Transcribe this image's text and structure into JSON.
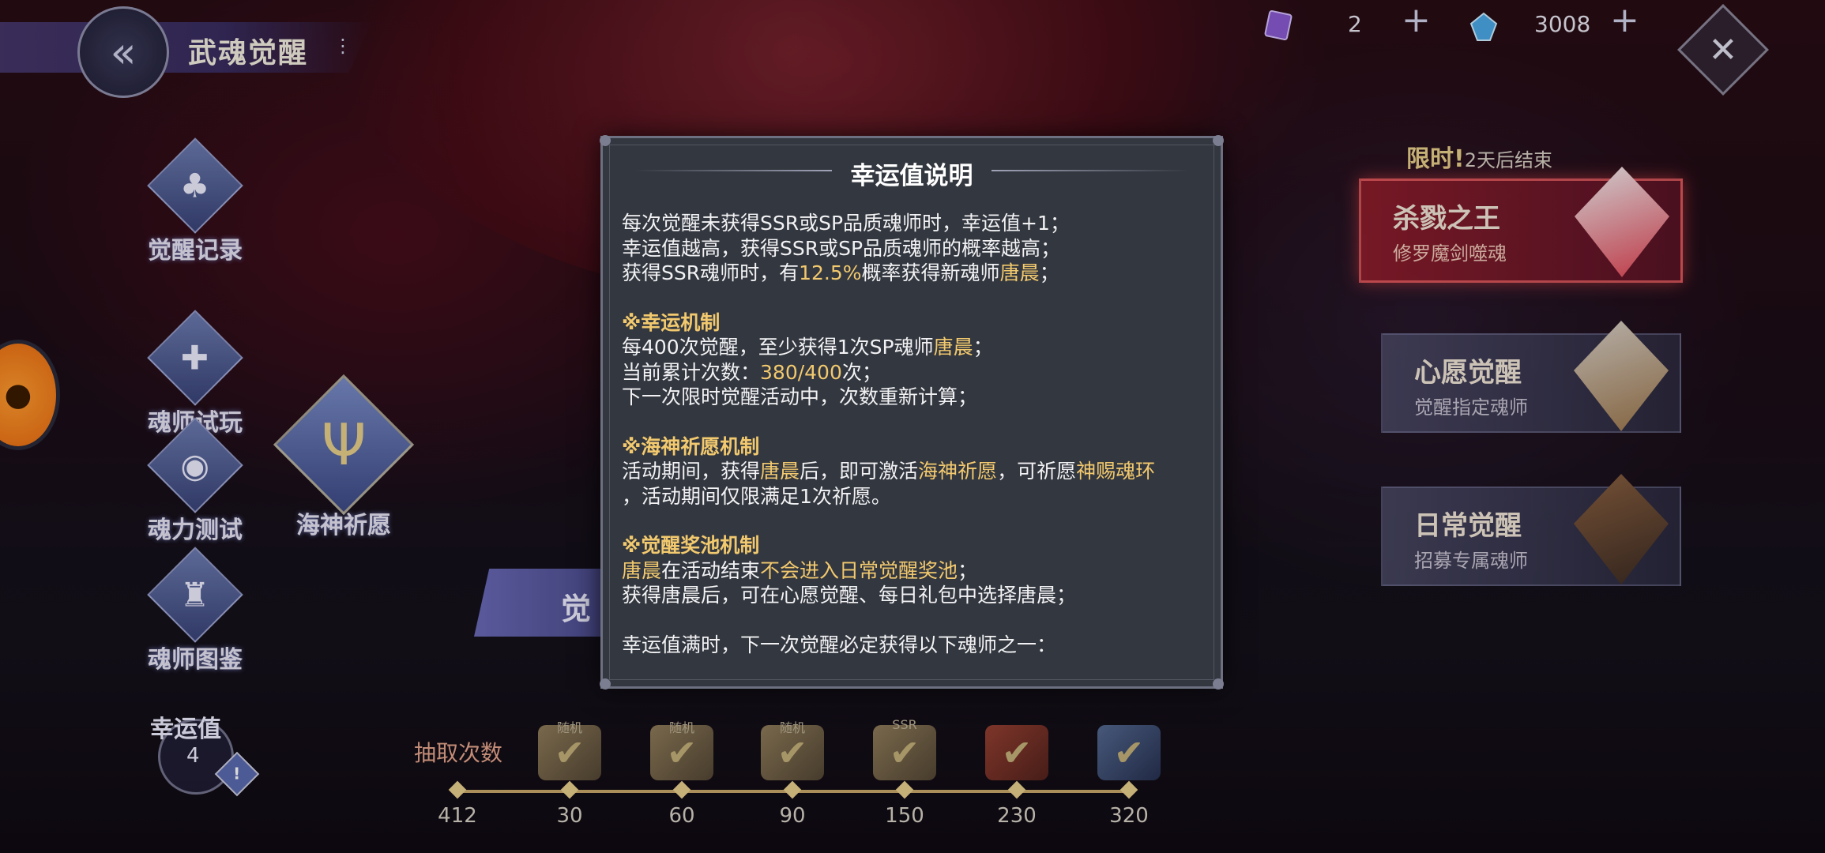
{
  "header": {
    "title": "武魂觉醒",
    "info_glyph": "⋮",
    "back_glyph": "«",
    "close_glyph": "✕"
  },
  "currencies": [
    {
      "icon": "purple-ticket-icon",
      "value": "2",
      "plus": "+"
    },
    {
      "icon": "blue-crystal-icon",
      "value": "3008",
      "plus": "+"
    }
  ],
  "left_menu": {
    "record": {
      "label": "觉醒记录",
      "icon": "card-record-icon",
      "glyph": "♣"
    },
    "trial": {
      "label": "魂师试玩",
      "icon": "gamepad-icon",
      "glyph": "✚"
    },
    "soul_test": {
      "label": "魂力测试",
      "icon": "camera-icon",
      "glyph": "◉"
    },
    "poseidon": {
      "label": "海神祈愿",
      "icon": "trident-icon",
      "glyph": "Ψ"
    },
    "codex": {
      "label": "魂师图鉴",
      "icon": "helmet-icon",
      "glyph": "♜"
    }
  },
  "luck": {
    "label": "幸运值",
    "value": "4",
    "info": "!"
  },
  "center_banner": {
    "label": "觉"
  },
  "draw_track": {
    "label": "抽取次数",
    "ticks": [
      "412",
      "30",
      "60",
      "90",
      "150",
      "230",
      "320"
    ],
    "rewards": [
      {
        "tag": "随机",
        "icon": "ssr-check-reward-icon"
      },
      {
        "tag": "随机",
        "icon": "ssr-check-reward-icon"
      },
      {
        "tag": "随机",
        "icon": "ssr-check-reward-icon"
      },
      {
        "tag": "SSR",
        "icon": "ssr-feather-reward-icon"
      },
      {
        "tag": "",
        "icon": "red-chest-reward-icon"
      },
      {
        "tag": "",
        "icon": "blue-chest-reward-icon"
      }
    ],
    "check_glyph": "✔"
  },
  "events": {
    "limit_label": "限时",
    "limit_time": "2天后结束",
    "cards": [
      {
        "title": "杀戮之王",
        "subtitle": "修罗魔剑噬魂",
        "portrait": "white-hair-demon-portrait"
      },
      {
        "title": "心愿觉醒",
        "subtitle": "觉醒指定魂师",
        "portrait": "goggles-boy-portrait"
      },
      {
        "title": "日常觉醒",
        "subtitle": "招募专属魂师",
        "portrait": "bearded-man-portrait"
      }
    ]
  },
  "popup": {
    "title": "幸运值说明",
    "intro": {
      "line1": "每次觉醒未获得SSR或SP品质魂师时，幸运值+1；",
      "line2": "幸运值越高，获得SSR或SP品质魂师的概率越高；",
      "line3_a": "获得SSR魂师时，有",
      "line3_rate": "12.5%",
      "line3_b": "概率获得新魂师",
      "line3_name": "唐晨",
      "line3_c": "；"
    },
    "luck_mech": {
      "heading": "※幸运机制",
      "line1_a": "每400次觉醒，至少获得1次SP魂师",
      "line1_name": "唐晨",
      "line1_b": "；",
      "line2_a": "当前累计次数：",
      "line2_count": "380/400",
      "line2_b": "次；",
      "line3": "下一次限时觉醒活动中，次数重新计算；"
    },
    "poseidon_mech": {
      "heading": "※海神祈愿机制",
      "line1_a": "活动期间，获得",
      "line1_name": "唐晨",
      "line1_b": "后，即可激活",
      "line1_feature": "海神祈愿",
      "line1_c": "，可祈愿",
      "line1_ring": "神赐魂环",
      "line2": "，活动期间仅限满足1次祈愿。"
    },
    "pool_mech": {
      "heading": "※觉醒奖池机制",
      "line1_name": "唐晨",
      "line1_a": "在活动结束",
      "line1_warn": "不会进入日常觉醒奖池",
      "line1_b": "；",
      "line2": "获得唐晨后，可在心愿觉醒、每日礼包中选择唐晨；"
    },
    "footer": "幸运值满时，下一次觉醒必定获得以下魂师之一："
  }
}
